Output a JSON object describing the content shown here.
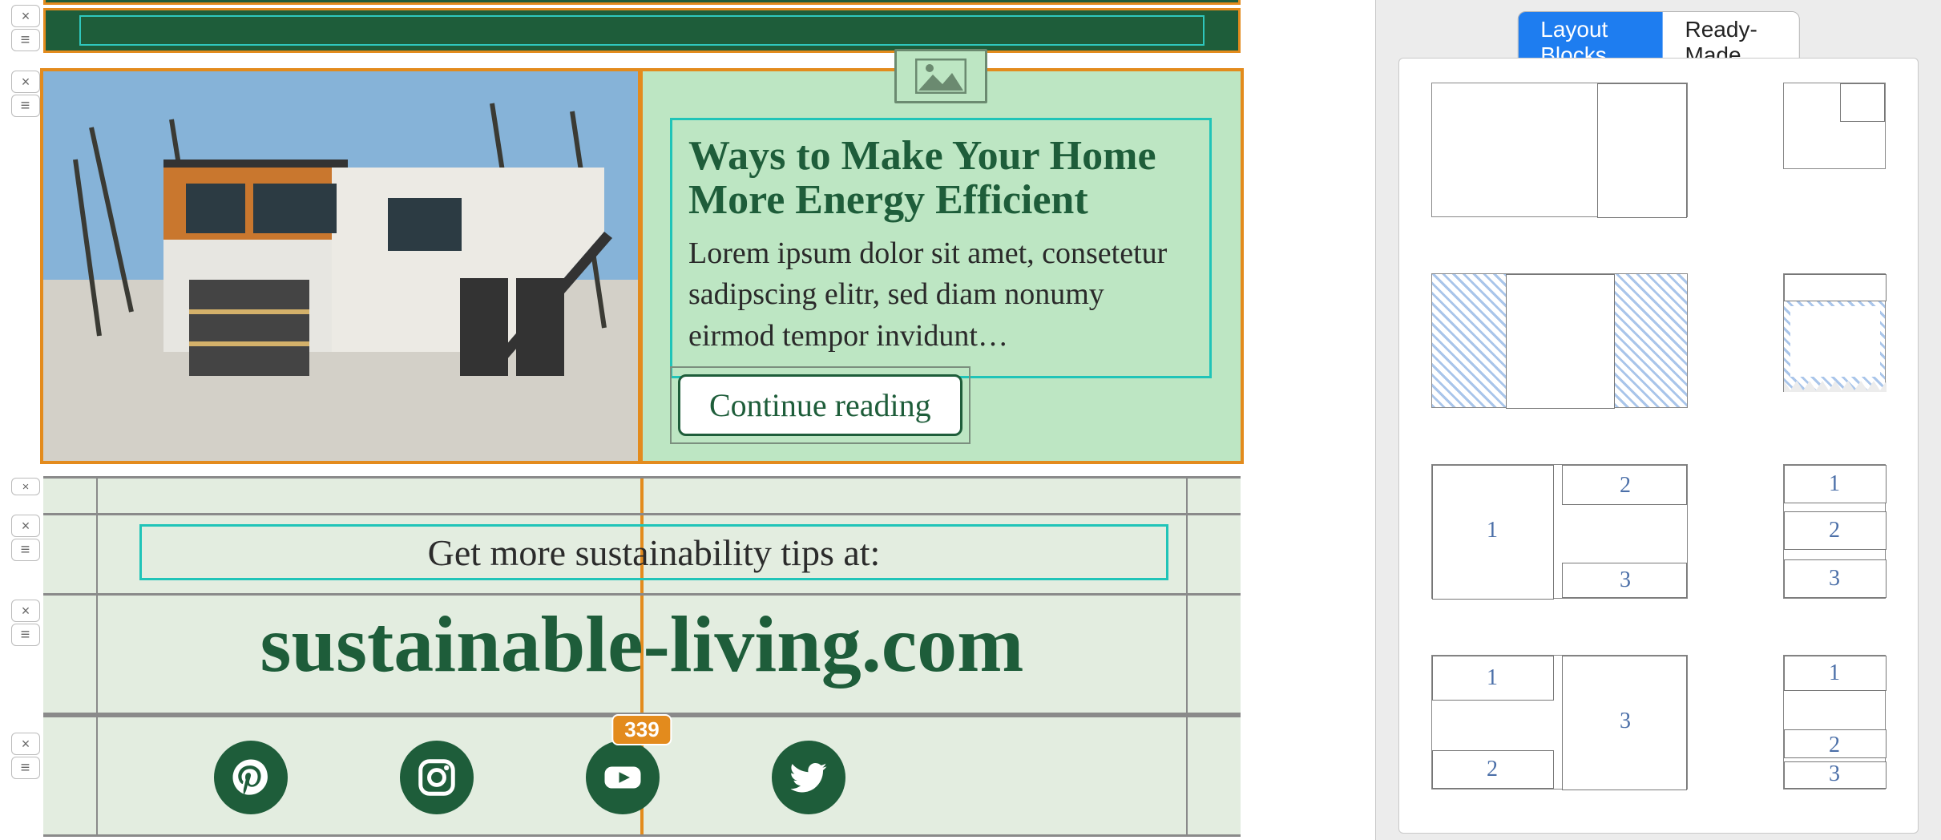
{
  "article": {
    "title": "Ways to Make Your Home More Energy Efficient",
    "body": "Lorem ipsum dolor sit amet, consetetur sadipscing elitr, sed diam nonumy eirmod tempor invidunt…",
    "cta_label": "Continue reading"
  },
  "footer": {
    "tips_label": "Get more sustainability tips at:",
    "site_url": "sustainable-living.com",
    "dimension_badge": "339"
  },
  "social": {
    "pinterest": "pinterest-icon",
    "instagram": "instagram-icon",
    "youtube": "youtube-icon",
    "twitter": "twitter-icon"
  },
  "sidebar": {
    "tab_layout": "Layout Blocks",
    "tab_ready": "Ready-Made"
  },
  "handles": {
    "close": "×",
    "drag": "≡"
  }
}
